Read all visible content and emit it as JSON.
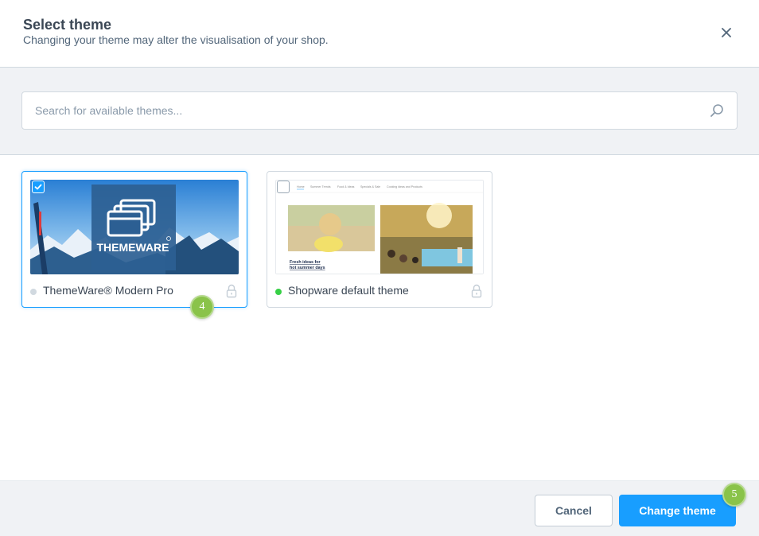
{
  "modal": {
    "title": "Select theme",
    "subtitle": "Changing your theme may alter the visualisation of your shop."
  },
  "search": {
    "placeholder": "Search for available themes...",
    "value": ""
  },
  "themes": [
    {
      "name": "ThemeWare® Modern Pro",
      "preview_text": "THEMEWARE",
      "selected": true,
      "status_color": "#d1d9e0",
      "locked": true,
      "icons": [
        "checkbox-checked-icon",
        "lock-icon"
      ]
    },
    {
      "name": "Shopware default theme",
      "preview_nav": [
        "Home",
        "Summer Trends",
        "Food & Ideas",
        "Specials & Sale",
        "Cooking ideas and Products"
      ],
      "preview_caption_line1": "Fresh ideas for",
      "preview_caption_line2": "hot summer days",
      "selected": false,
      "status_color": "#37d046",
      "locked": true,
      "icons": [
        "checkbox-empty-icon",
        "lock-icon"
      ]
    }
  ],
  "annotations": {
    "badge_theme": "4",
    "badge_button": "5"
  },
  "footer": {
    "cancel_label": "Cancel",
    "confirm_label": "Change theme"
  },
  "colors": {
    "accent": "#189eff",
    "badge": "#8ac34a",
    "active_status": "#37d046",
    "inactive_status": "#d1d9e0"
  }
}
